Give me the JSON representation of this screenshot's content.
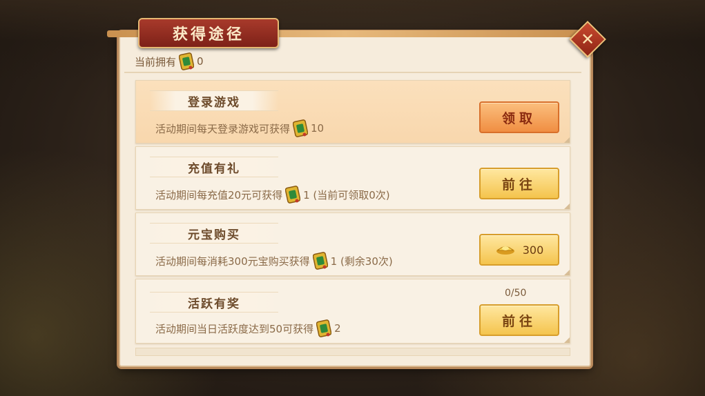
{
  "dialog": {
    "title": "获得途径",
    "close_label": "✕"
  },
  "owned": {
    "label": "当前拥有",
    "count": "0",
    "icon": "scroll-token-icon"
  },
  "rows": [
    {
      "name": "登录游戏",
      "desc_prefix": "活动期间每天登录游戏可获得",
      "desc_suffix": "10",
      "button": "领取",
      "style": "orange"
    },
    {
      "name": "充值有礼",
      "desc_prefix": "活动期间每充值20元可获得",
      "desc_suffix": "1 (当前可领取0次)",
      "button": "前往",
      "style": "yellow"
    },
    {
      "name": "元宝购买",
      "desc_prefix": "活动期间每消耗300元宝购买获得",
      "desc_suffix": "1 (剩余30次)",
      "button": "300",
      "button_icon": "gold-ingot-icon",
      "style": "yellow"
    },
    {
      "name": "活跃有奖",
      "desc_prefix": "活动期间当日活跃度达到50可获得",
      "desc_suffix": "2",
      "button": "前往",
      "progress": "0/50",
      "style": "yellow"
    }
  ],
  "colors": {
    "title_plate": "#a83a2b",
    "panel_bg": "#f6ecdc",
    "button_orange": "#f08e42",
    "button_yellow": "#f4c44d",
    "token_green": "#2f8a3a",
    "token_gold": "#e0b531"
  }
}
